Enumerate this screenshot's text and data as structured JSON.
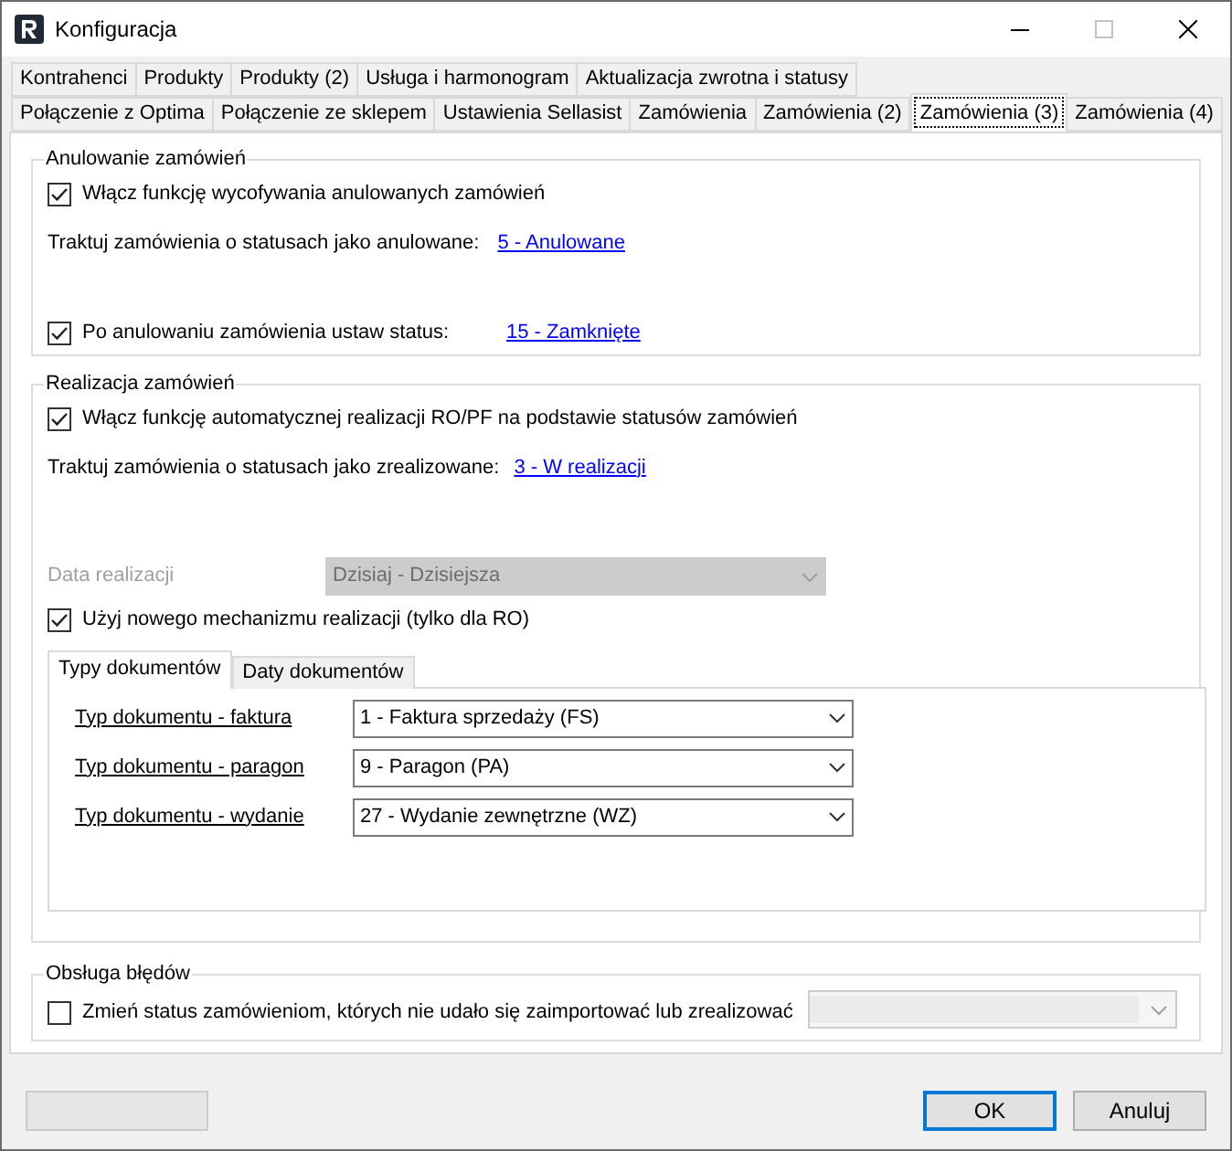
{
  "window": {
    "title": "Konfiguracja"
  },
  "tab_rows": [
    [
      {
        "label": "Kontrahenci",
        "selected": false
      },
      {
        "label": "Produkty",
        "selected": false
      },
      {
        "label": "Produkty (2)",
        "selected": false
      },
      {
        "label": "Usługa i harmonogram",
        "selected": false
      },
      {
        "label": "Aktualizacja zwrotna i statusy",
        "selected": false
      }
    ],
    [
      {
        "label": "Połączenie z Optima",
        "selected": false
      },
      {
        "label": "Połączenie ze sklepem",
        "selected": false
      },
      {
        "label": "Ustawienia Sellasist",
        "selected": false
      },
      {
        "label": "Zamówienia",
        "selected": false
      },
      {
        "label": "Zamówienia (2)",
        "selected": false
      },
      {
        "label": "Zamówienia (3)",
        "selected": true
      },
      {
        "label": "Zamówienia (4)",
        "selected": false
      }
    ]
  ],
  "cancel_group": {
    "title": "Anulowanie zamówień",
    "enable": {
      "label": "Włącz funkcję wycofywania anulowanych zamówień",
      "checked": true
    },
    "treat_as": {
      "label": "Traktuj zamówienia o statusach jako anulowane:",
      "link": "5 - Anulowane"
    },
    "set_status": {
      "label": "Po anulowaniu zamówienia ustaw status:",
      "checked": true,
      "link": "15 - Zamknięte"
    }
  },
  "realization_group": {
    "title": "Realizacja zamówień",
    "enable": {
      "label": "Włącz funkcję automatycznej realizacji RO/PF na podstawie statusów zamówień",
      "checked": true
    },
    "treat_as": {
      "label": "Traktuj zamówienia o statusach jako zrealizowane:",
      "link": "3 - W realizacji"
    },
    "date": {
      "label": "Data realizacji",
      "value": "Dzisiaj - Dzisiejsza",
      "disabled": true
    },
    "new_mechanism": {
      "label": "Użyj nowego mechanizmu realizacji (tylko dla RO)",
      "checked": true
    },
    "tabs": [
      {
        "label": "Typy dokumentów",
        "selected": true
      },
      {
        "label": "Daty dokumentów",
        "selected": false
      }
    ],
    "document_types": [
      {
        "label": "Typ dokumentu - faktura",
        "value": "1 - Faktura sprzedaży (FS)"
      },
      {
        "label": "Typ dokumentu - paragon",
        "value": "9 - Paragon (PA)"
      },
      {
        "label": "Typ dokumentu - wydanie",
        "value": "27 - Wydanie zewnętrzne (WZ)"
      }
    ]
  },
  "errors_group": {
    "title": "Obsługa błędów",
    "change_status": {
      "label": "Zmień status zamówieniom, których nie udało się zaimportować lub zrealizować",
      "checked": false
    },
    "status_dropdown": {
      "disabled": true
    }
  },
  "buttons": [
    {
      "kind": "blank",
      "disabled": true
    },
    {
      "kind": "default",
      "label": "OK",
      "disabled": false
    },
    {
      "kind": "normal",
      "label": "Anuluj",
      "disabled": false
    }
  ]
}
